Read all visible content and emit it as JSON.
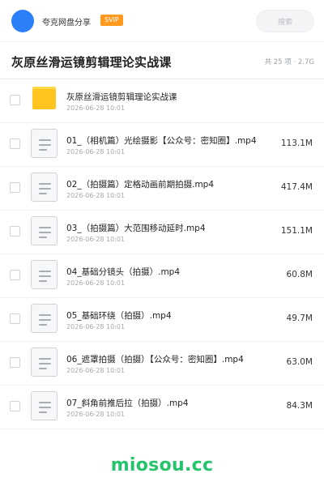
{
  "header": {
    "app_name": "夸克网盘分享",
    "vip_badge": "SVIP",
    "search_placeholder": "搜索",
    "colors": {
      "avatar": "#2d7ff9",
      "vip": "#ff9a1f"
    }
  },
  "folder": {
    "title": "灰原丝滑运镜剪辑理论实战课",
    "meta": "共 25 项 · 2.7G"
  },
  "files": [
    {
      "type": "folder",
      "icon": "folder-icon",
      "name": "灰原丝滑运镜剪辑理论实战课",
      "date": "2026-06-28 10:01",
      "size": ""
    },
    {
      "type": "file",
      "icon": "document-icon",
      "name": "01_（相机篇）光绘摄影【公众号：密知圈】.mp4",
      "date": "2026-06-28 10:01",
      "size": "113.1M"
    },
    {
      "type": "file",
      "icon": "document-icon",
      "name": "02_（拍摄篇）定格动画前期拍摄.mp4",
      "date": "2026-06-28 10:01",
      "size": "417.4M"
    },
    {
      "type": "file",
      "icon": "document-icon",
      "name": "03_（拍摄篇）大范围移动延时.mp4",
      "date": "2026-06-28 10:01",
      "size": "151.1M"
    },
    {
      "type": "file",
      "icon": "document-icon",
      "name": "04_基础分镜头（拍摄）.mp4",
      "date": "2026-06-28 10:01",
      "size": "60.8M"
    },
    {
      "type": "file",
      "icon": "document-icon",
      "name": "05_基础环绕（拍摄）.mp4",
      "date": "2026-06-28 10:01",
      "size": "49.7M"
    },
    {
      "type": "file",
      "icon": "document-icon",
      "name": "06_遮罩拍摄（拍摄）【公众号：密知圈】.mp4",
      "date": "2026-06-28 10:01",
      "size": "63.0M"
    },
    {
      "type": "file",
      "icon": "document-icon",
      "name": "07_斜角前推后拉（拍摄）.mp4",
      "date": "2026-06-28 10:01",
      "size": "84.3M"
    }
  ],
  "watermark": {
    "text": "miosou.cc",
    "color": "#25c36b"
  }
}
